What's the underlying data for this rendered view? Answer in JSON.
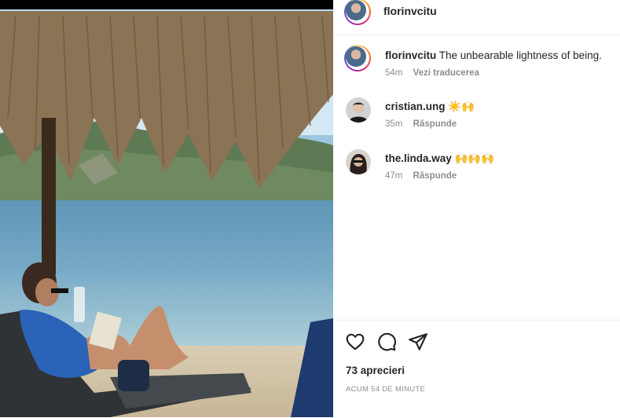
{
  "post": {
    "username": "florinvcitu",
    "caption": "The unbearable lightness of being.",
    "caption_time": "54m",
    "translate_label": "Vezi traducerea"
  },
  "comments": [
    {
      "username": "cristian.ung",
      "text": "☀️🙌",
      "time": "35m",
      "reply_label": "Răspunde"
    },
    {
      "username": "the.linda.way",
      "text": "🙌🙌🙌",
      "time": "47m",
      "reply_label": "Răspunde"
    }
  ],
  "stats": {
    "likes": "73 aprecieri",
    "posted": "ACUM 54 DE MINUTE"
  },
  "icons": [
    "heart-icon",
    "comment-icon",
    "share-icon"
  ],
  "colors": {
    "story_ring": "#d62976",
    "muted_text": "#8e8e8e"
  }
}
